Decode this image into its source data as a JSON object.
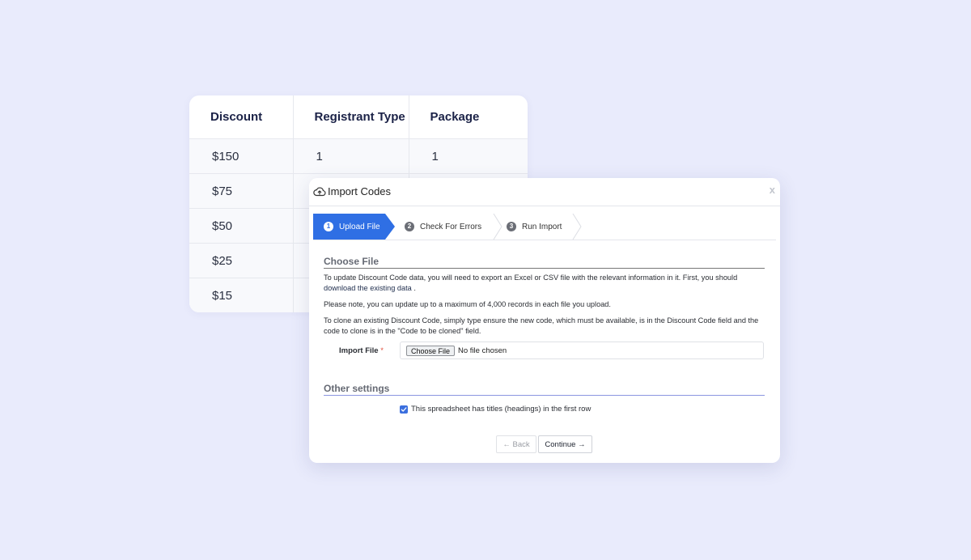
{
  "table": {
    "headers": [
      "Discount",
      "Registrant Type",
      "Package"
    ],
    "rows": [
      [
        "$150",
        "1",
        "1"
      ],
      [
        "$75",
        "",
        ""
      ],
      [
        "$50",
        "",
        ""
      ],
      [
        "$25",
        "",
        ""
      ],
      [
        "$15",
        "",
        ""
      ]
    ]
  },
  "modal": {
    "title": "Import Codes",
    "title_icon": "cloud-upload-icon",
    "close": "x",
    "steps": [
      {
        "num": "1",
        "label": "Upload File"
      },
      {
        "num": "2",
        "label": "Check For Errors"
      },
      {
        "num": "3",
        "label": "Run Import"
      }
    ],
    "choose_file": {
      "title": "Choose File",
      "para1_start": "To update Discount Code data, you will need to export an Excel or CSV file with the relevant information in it. First, you should",
      "para1_link": "download the existing data",
      "para1_end": ".",
      "para2": "Please note, you can update up to a maximum of 4,000 records in each file you upload.",
      "para3": "To clone an existing Discount Code, simply type ensure the new code, which must be available, is in the Discount Code field and the code to clone is in the \"Code to be cloned\" field.",
      "import_label": "Import File",
      "required_mark": "*",
      "choose_button": "Choose File",
      "no_file": "No file chosen"
    },
    "other_settings": {
      "title": "Other settings",
      "checkbox_label": "This spreadsheet has titles (headings) in the first row",
      "checked": true
    },
    "buttons": {
      "back": "← Back",
      "continue": "Continue →"
    }
  },
  "colors": {
    "background": "#e9ebfc",
    "accent": "#2f6fe4"
  }
}
